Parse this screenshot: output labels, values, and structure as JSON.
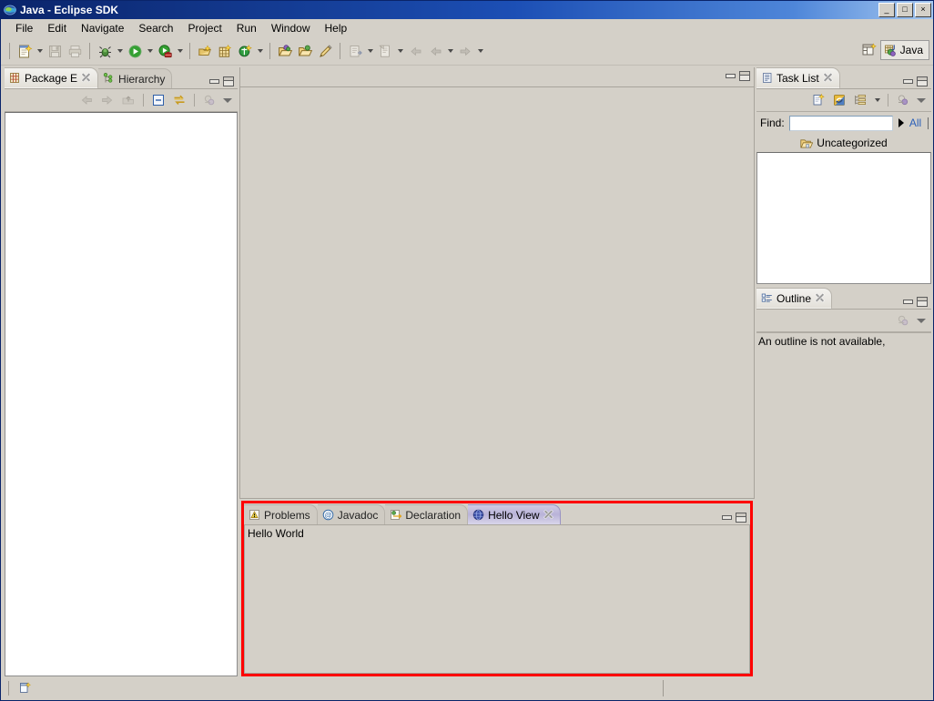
{
  "window": {
    "title": "Java - Eclipse SDK",
    "icon": "eclipse-icon",
    "minimize_label": "_",
    "maximize_label": "□",
    "close_label": "×"
  },
  "menubar": {
    "items": [
      {
        "label": "File"
      },
      {
        "label": "Edit"
      },
      {
        "label": "Navigate"
      },
      {
        "label": "Search"
      },
      {
        "label": "Project"
      },
      {
        "label": "Run"
      },
      {
        "label": "Window"
      },
      {
        "label": "Help"
      }
    ]
  },
  "toolbar": {
    "groups": [
      {
        "buttons": [
          {
            "name": "new-wizard-icon",
            "has_dropdown": true
          },
          {
            "name": "save-icon",
            "has_dropdown": false
          },
          {
            "name": "print-icon",
            "has_dropdown": false
          }
        ]
      },
      {
        "buttons": [
          {
            "name": "debug-icon",
            "has_dropdown": true
          },
          {
            "name": "run-icon",
            "has_dropdown": true
          },
          {
            "name": "external-tools-icon",
            "has_dropdown": true
          }
        ]
      },
      {
        "buttons": [
          {
            "name": "new-java-package-icon",
            "has_dropdown": false
          },
          {
            "name": "new-java-class-icon",
            "has_dropdown": false
          },
          {
            "name": "new-java-interface-icon",
            "has_dropdown": true
          }
        ]
      },
      {
        "buttons": [
          {
            "name": "open-type-icon",
            "has_dropdown": false
          },
          {
            "name": "open-task-icon",
            "has_dropdown": false
          },
          {
            "name": "search-icon",
            "has_dropdown": false
          }
        ]
      },
      {
        "buttons": [
          {
            "name": "next-annotation-icon",
            "has_dropdown": true
          },
          {
            "name": "last-edit-location-icon",
            "has_dropdown": true
          },
          {
            "name": "back-icon",
            "has_dropdown": false
          },
          {
            "name": "previous-icon",
            "has_dropdown": true
          },
          {
            "name": "forward-icon",
            "has_dropdown": true
          }
        ]
      }
    ],
    "perspective": {
      "open_perspective_icon": "open-perspective-icon",
      "active_label": "Java",
      "active_icon": "java-perspective-icon"
    }
  },
  "package_explorer": {
    "tabs": [
      {
        "label": "Package E",
        "icon": "package-explorer-icon",
        "active": true,
        "closable": true
      },
      {
        "label": "Hierarchy",
        "icon": "hierarchy-icon",
        "active": false,
        "closable": false
      }
    ],
    "toolbar": [
      {
        "name": "back-icon"
      },
      {
        "name": "forward-icon"
      },
      {
        "name": "up-icon"
      },
      {
        "name": "collapse-all-icon"
      },
      {
        "name": "link-with-editor-icon"
      },
      {
        "name": "focus-on-active-task-icon"
      },
      {
        "name": "view-menu-icon"
      }
    ],
    "content": ""
  },
  "editor_area": {
    "content": "",
    "controls": [
      {
        "name": "minimize-icon"
      },
      {
        "name": "maximize-icon"
      }
    ]
  },
  "task_list": {
    "tab": {
      "label": "Task List",
      "icon": "task-list-icon",
      "closable": true
    },
    "toolbar": [
      {
        "name": "new-task-icon"
      },
      {
        "name": "synchronize-changed-icon"
      },
      {
        "name": "categorize-icon",
        "has_dropdown": true
      },
      {
        "name": "focus-on-workweek-icon"
      },
      {
        "name": "view-menu-icon"
      }
    ],
    "find": {
      "label": "Find:",
      "value": "",
      "placeholder": "",
      "scope_label": "All"
    },
    "category": {
      "label": "Uncategorized",
      "icon": "folder-icon"
    },
    "items": []
  },
  "outline": {
    "tab": {
      "label": "Outline",
      "icon": "outline-icon",
      "closable": true
    },
    "toolbar": [
      {
        "name": "focus-on-active-task-icon"
      },
      {
        "name": "view-menu-icon"
      }
    ],
    "message": "An outline is not available,"
  },
  "bottom_panel": {
    "highlighted": true,
    "highlight_color": "#ff0000",
    "tabs": [
      {
        "label": "Problems",
        "icon": "problems-icon",
        "active": false,
        "closable": false
      },
      {
        "label": "Javadoc",
        "icon": "javadoc-icon",
        "active": false,
        "closable": false
      },
      {
        "label": "Declaration",
        "icon": "declaration-icon",
        "active": false,
        "closable": false
      },
      {
        "label": "Hello View",
        "icon": "hello-view-icon",
        "active": true,
        "closable": true
      }
    ],
    "content": "Hello World",
    "controls": [
      {
        "name": "minimize-icon"
      },
      {
        "name": "maximize-icon"
      }
    ]
  },
  "statusbar": {
    "icon": "editor-status-icon",
    "text": ""
  }
}
